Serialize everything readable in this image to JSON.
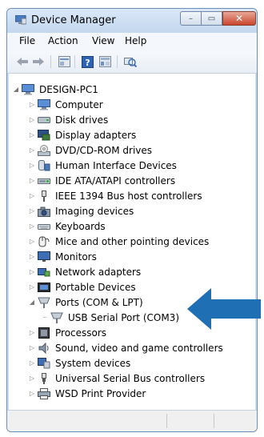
{
  "window": {
    "title": "Device Manager",
    "controls": {
      "minimize": "–",
      "maximize": "▭",
      "close": "✕"
    }
  },
  "menu": {
    "file": "File",
    "action": "Action",
    "view": "View",
    "help": "Help"
  },
  "toolbar_icons": [
    "back-icon",
    "forward-icon",
    "properties-icon",
    "help-icon",
    "show-hidden-icon",
    "scan-hardware-icon"
  ],
  "tree": {
    "root": {
      "label": "DESIGN-PC1",
      "icon": "computer-icon",
      "expanded": true
    },
    "items": [
      {
        "label": "Computer",
        "icon": "computer-icon",
        "expanded": false
      },
      {
        "label": "Disk drives",
        "icon": "disk-drive-icon",
        "expanded": false
      },
      {
        "label": "Display adapters",
        "icon": "display-adapter-icon",
        "expanded": false
      },
      {
        "label": "DVD/CD-ROM drives",
        "icon": "dvd-drive-icon",
        "expanded": false
      },
      {
        "label": "Human Interface Devices",
        "icon": "hid-icon",
        "expanded": false
      },
      {
        "label": "IDE ATA/ATAPI controllers",
        "icon": "ide-controller-icon",
        "expanded": false
      },
      {
        "label": "IEEE 1394 Bus host controllers",
        "icon": "firewire-icon",
        "expanded": false
      },
      {
        "label": "Imaging devices",
        "icon": "imaging-device-icon",
        "expanded": false
      },
      {
        "label": "Keyboards",
        "icon": "keyboard-icon",
        "expanded": false
      },
      {
        "label": "Mice and other pointing devices",
        "icon": "mouse-icon",
        "expanded": false
      },
      {
        "label": "Monitors",
        "icon": "monitor-icon",
        "expanded": false
      },
      {
        "label": "Network adapters",
        "icon": "network-adapter-icon",
        "expanded": false
      },
      {
        "label": "Portable Devices",
        "icon": "portable-device-icon",
        "expanded": false
      },
      {
        "label": "Ports (COM & LPT)",
        "icon": "port-icon",
        "expanded": true
      },
      {
        "label": "USB Serial Port (COM3)",
        "icon": "port-icon",
        "child": true
      },
      {
        "label": "Processors",
        "icon": "processor-icon",
        "expanded": false
      },
      {
        "label": "Sound, video and game controllers",
        "icon": "sound-icon",
        "expanded": false
      },
      {
        "label": "System devices",
        "icon": "system-device-icon",
        "expanded": false
      },
      {
        "label": "Universal Serial Bus controllers",
        "icon": "usb-icon",
        "expanded": false
      },
      {
        "label": "WSD Print Provider",
        "icon": "printer-icon",
        "expanded": false
      }
    ]
  },
  "colors": {
    "arrow": "#1f6fb4",
    "title_bg": "#c9dcf2",
    "close_button": "#c9462c"
  }
}
